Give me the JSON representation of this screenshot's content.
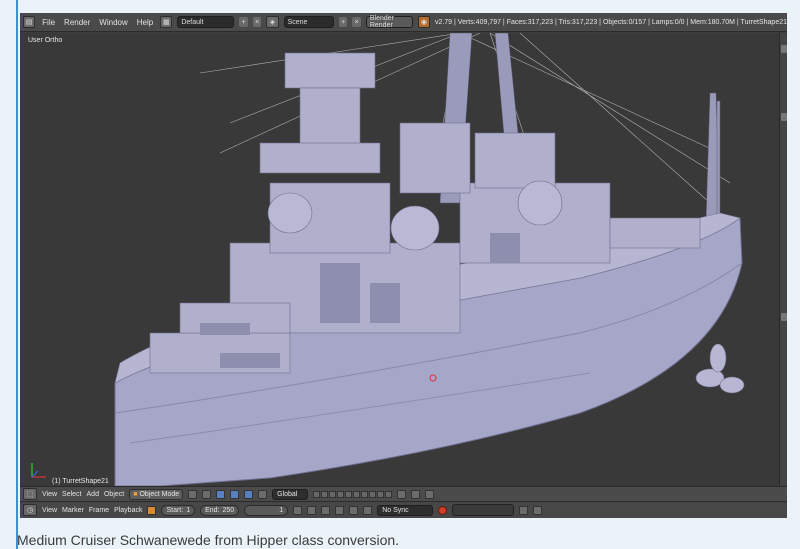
{
  "topbar": {
    "menus": [
      "File",
      "Render",
      "Window",
      "Help"
    ],
    "layout": "Default",
    "scene": "Scene",
    "engine": "Blender Render",
    "stats": "v2.79 | Verts:409,797 | Faces:317,223 | Tris:317,223 | Objects:0/157 | Lamps:0/0 | Mem:180.70M | TurretShape21"
  },
  "viewport": {
    "view_name": "User Ortho",
    "active_object": "(1) TurretShape21"
  },
  "header3d": {
    "menus": [
      "View",
      "Select",
      "Add",
      "Object"
    ],
    "mode": "Object Mode",
    "orientation": "Global"
  },
  "timeline": {
    "menus": [
      "View",
      "Marker",
      "Frame",
      "Playback"
    ],
    "start_label": "Start:",
    "start_value": "1",
    "end_label": "End:",
    "end_value": "250",
    "current_frame": "1",
    "sync": "No Sync"
  },
  "caption": "Medium Cruiser Schwanewede from Hipper class conversion.",
  "colors": {
    "accent": "#3d8fd6",
    "hull": "#a6a6c8",
    "background": "#393939"
  }
}
